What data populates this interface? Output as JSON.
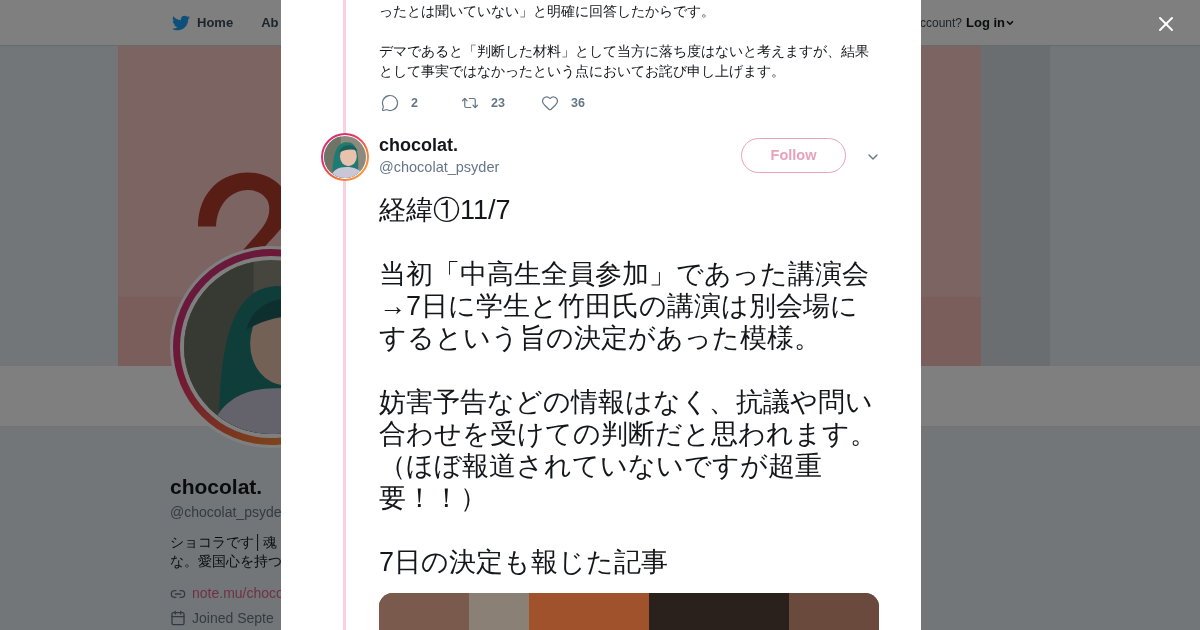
{
  "background_page": {
    "nav": [
      {
        "label": "Home"
      },
      {
        "label": "Ab"
      }
    ],
    "account_prompt": "ccount?",
    "login": "Log in",
    "profile": {
      "name": "chocolat.",
      "handle": "@chocolat_psyde",
      "bio": [
        "ショコラです│魂",
        "な。愛国心を持つ"
      ],
      "link": "note.mu/choco",
      "joined": "Joined Septe"
    }
  },
  "previous_tweet": {
    "paragraphs": [
      "ったとは聞いていない」と明確に回答したからです。",
      "デマであると「判断した材料」として当方に落ち度はないと考えますが、結果として事実ではなかったという点においてお詫び申し上げます。"
    ],
    "actions": [
      {
        "kind": "reply",
        "count": "2"
      },
      {
        "kind": "retweet",
        "count": "23"
      },
      {
        "kind": "like",
        "count": "36"
      }
    ]
  },
  "tweet": {
    "name": "chocolat.",
    "handle": "@chocolat_psyder",
    "follow": "Follow",
    "paragraphs": [
      [
        "経緯①11/7"
      ],
      [
        "当初「中高生全員参加」であった講演会",
        "→7日に学生と竹田氏の講演は別会場にするという旨の決定があった模様。"
      ],
      [
        "妨害予告などの情報はなく、抗議や問い合わせを受けての判断だと思われます。",
        "（ほぼ報道されていないですが超重要！！）"
      ],
      [
        "7日の決定も報じた記事"
      ]
    ],
    "media": {
      "kind": "picture"
    }
  }
}
